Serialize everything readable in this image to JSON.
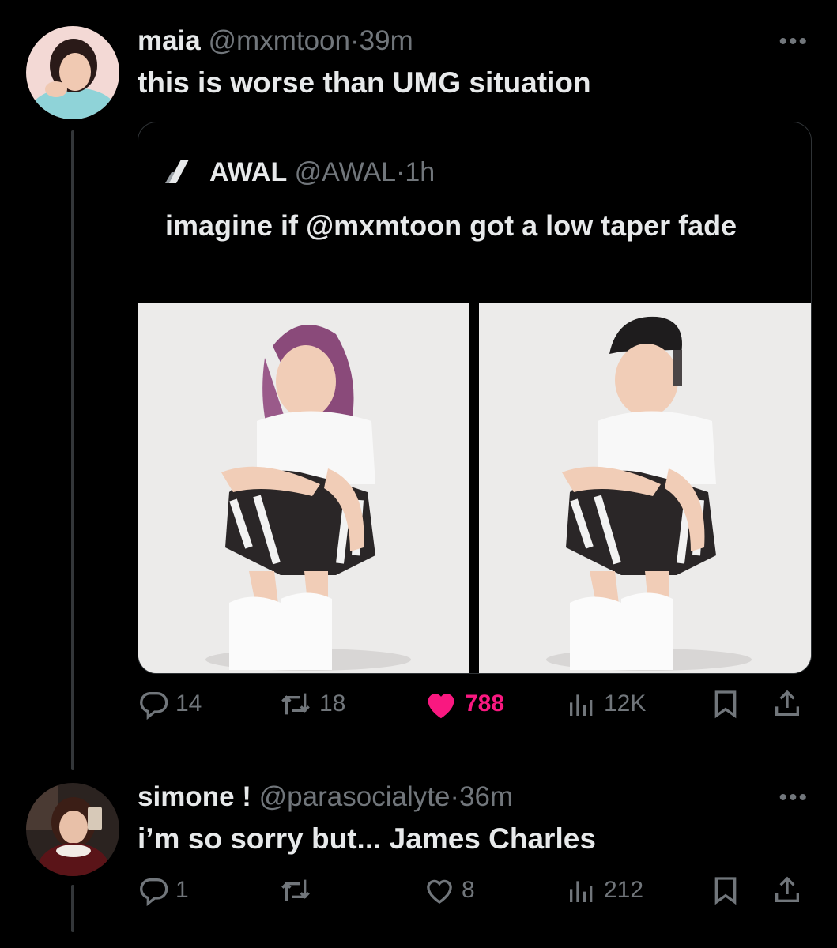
{
  "colors": {
    "background": "#000000",
    "text": "#e7e9ea",
    "muted": "#71767b",
    "like": "#f91880"
  },
  "tweets": [
    {
      "name": "maia",
      "handle": "@mxmtoon",
      "dot": "·",
      "time": "39m",
      "text": "this is worse than UMG situation",
      "more": "•••",
      "quote": {
        "name": "AWAL",
        "handle": "@AWAL",
        "dot": "·",
        "time": "1h",
        "text": "imagine if @mxmtoon got a low taper fade",
        "images": [
          "person-photo-original",
          "person-photo-edited"
        ]
      },
      "stats": {
        "replies": "14",
        "reposts": "18",
        "likes": "788",
        "views": "12K",
        "liked": true
      }
    },
    {
      "name": "simone !",
      "handle": "@parasocialyte",
      "dot": "·",
      "time": "36m",
      "text": "i’m so sorry but... James Charles",
      "more": "•••",
      "stats": {
        "replies": "1",
        "reposts": "",
        "likes": "8",
        "views": "212",
        "liked": false
      }
    }
  ],
  "icons": [
    "reply-icon",
    "repost-icon",
    "like-icon",
    "views-icon",
    "bookmark-icon",
    "share-icon",
    "more-icon",
    "awal-logo"
  ]
}
